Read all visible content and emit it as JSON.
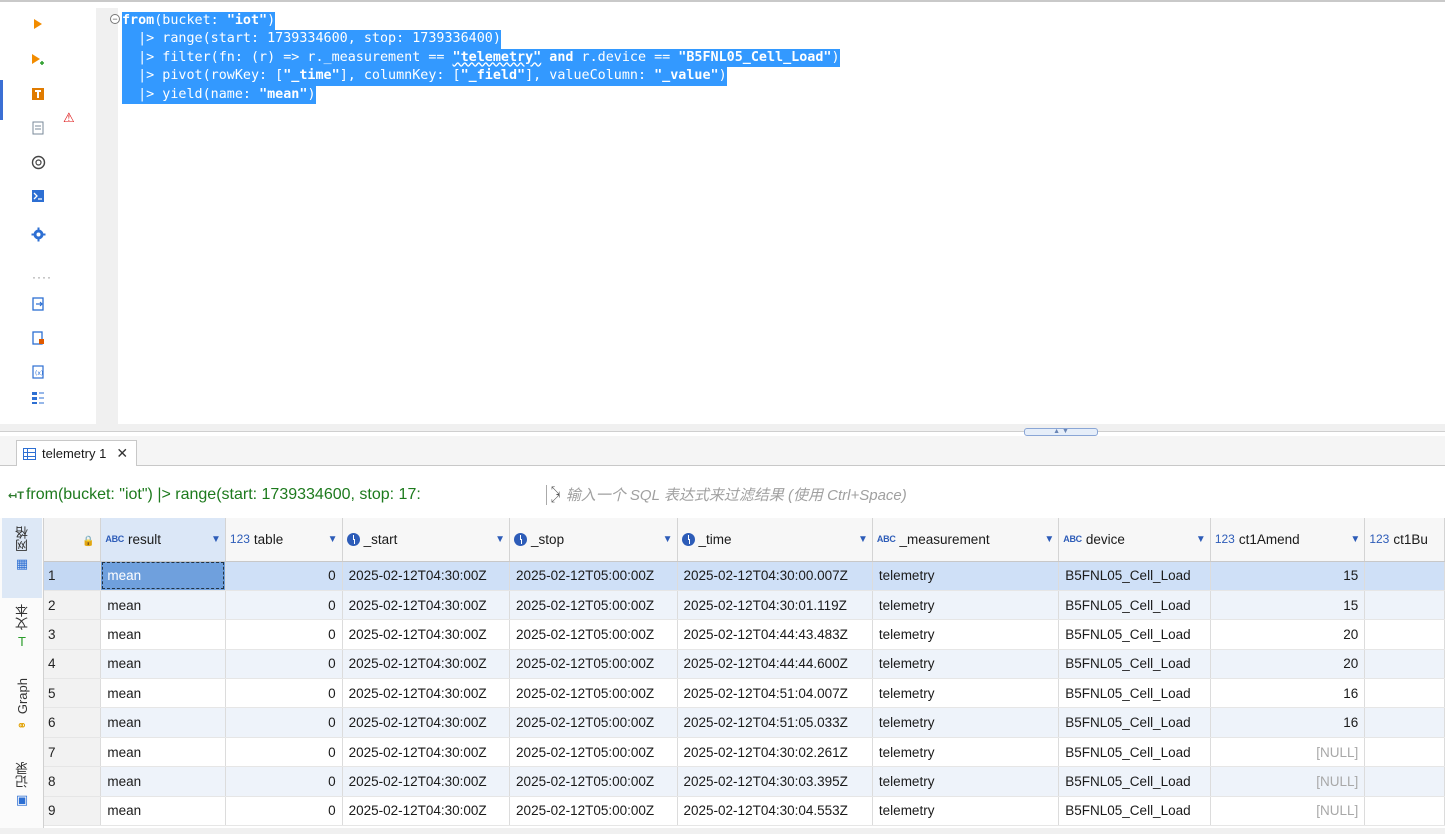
{
  "editor": {
    "lines": [
      {
        "p1": "from",
        "p2": "(bucket: ",
        "p3": "\"iot\"",
        "p4": ")"
      },
      {
        "text": "  |> range(start: 1739334600, stop: 1739336400)"
      },
      {
        "p1": "  |> filter(fn: (r) => r._measurement == ",
        "p2": "\"telemetry\"",
        "p3": " and ",
        "p4": "r.device == ",
        "p5": "\"B5FNL05_Cell_Load\"",
        "p6": ")"
      },
      {
        "p1": "  |> pivot(rowKey: [",
        "p2": "\"_time\"",
        "p3": "], columnKey: [",
        "p4": "\"_field\"",
        "p5": "], valueColumn: ",
        "p6": "\"_value\"",
        "p7": ")"
      },
      {
        "p1": "  |> yield(name: ",
        "p2": "\"mean\"",
        "p3": ")"
      }
    ],
    "toolbar_icons": [
      "run-icon",
      "run-script-icon",
      "explain-icon",
      "export-icon",
      "openai-icon",
      "terminal-icon",
      "settings-icon",
      "load-script-icon",
      "new-script-icon",
      "script-variables-icon",
      "outline-icon"
    ],
    "selection_color": "#3399ff"
  },
  "results": {
    "tab_label": "telemetry 1",
    "tab_close": "✕",
    "filter_query": "from(bucket: \"iot\") |> range(start: 1739334600, stop: 17:",
    "filter_placeholder": "输入一个 SQL 表达式来过滤结果 (使用 Ctrl+Space)",
    "side_tabs": {
      "grid": "网格",
      "text": "文本",
      "graph": "Graph",
      "records": "记录"
    },
    "columns": [
      {
        "type": "ABC",
        "name": "result"
      },
      {
        "type": "123",
        "name": "table"
      },
      {
        "type": "time",
        "name": "_start"
      },
      {
        "type": "time",
        "name": "_stop"
      },
      {
        "type": "time",
        "name": "_time"
      },
      {
        "type": "ABC",
        "name": "_measurement"
      },
      {
        "type": "ABC",
        "name": "device"
      },
      {
        "type": "123",
        "name": "ct1Amend"
      },
      {
        "type": "123",
        "name": "ct1Bu"
      }
    ],
    "rows": [
      {
        "n": "1",
        "result": "mean",
        "table": "0",
        "start": "2025-02-12T04:30:00Z",
        "stop": "2025-02-12T05:00:00Z",
        "time": "2025-02-12T04:30:00.007Z",
        "measurement": "telemetry",
        "device": "B5FNL05_Cell_Load",
        "ct1Amend": "15"
      },
      {
        "n": "2",
        "result": "mean",
        "table": "0",
        "start": "2025-02-12T04:30:00Z",
        "stop": "2025-02-12T05:00:00Z",
        "time": "2025-02-12T04:30:01.119Z",
        "measurement": "telemetry",
        "device": "B5FNL05_Cell_Load",
        "ct1Amend": "15"
      },
      {
        "n": "3",
        "result": "mean",
        "table": "0",
        "start": "2025-02-12T04:30:00Z",
        "stop": "2025-02-12T05:00:00Z",
        "time": "2025-02-12T04:44:43.483Z",
        "measurement": "telemetry",
        "device": "B5FNL05_Cell_Load",
        "ct1Amend": "20"
      },
      {
        "n": "4",
        "result": "mean",
        "table": "0",
        "start": "2025-02-12T04:30:00Z",
        "stop": "2025-02-12T05:00:00Z",
        "time": "2025-02-12T04:44:44.600Z",
        "measurement": "telemetry",
        "device": "B5FNL05_Cell_Load",
        "ct1Amend": "20"
      },
      {
        "n": "5",
        "result": "mean",
        "table": "0",
        "start": "2025-02-12T04:30:00Z",
        "stop": "2025-02-12T05:00:00Z",
        "time": "2025-02-12T04:51:04.007Z",
        "measurement": "telemetry",
        "device": "B5FNL05_Cell_Load",
        "ct1Amend": "16"
      },
      {
        "n": "6",
        "result": "mean",
        "table": "0",
        "start": "2025-02-12T04:30:00Z",
        "stop": "2025-02-12T05:00:00Z",
        "time": "2025-02-12T04:51:05.033Z",
        "measurement": "telemetry",
        "device": "B5FNL05_Cell_Load",
        "ct1Amend": "16"
      },
      {
        "n": "7",
        "result": "mean",
        "table": "0",
        "start": "2025-02-12T04:30:00Z",
        "stop": "2025-02-12T05:00:00Z",
        "time": "2025-02-12T04:30:02.261Z",
        "measurement": "telemetry",
        "device": "B5FNL05_Cell_Load",
        "ct1Amend": "[NULL]"
      },
      {
        "n": "8",
        "result": "mean",
        "table": "0",
        "start": "2025-02-12T04:30:00Z",
        "stop": "2025-02-12T05:00:00Z",
        "time": "2025-02-12T04:30:03.395Z",
        "measurement": "telemetry",
        "device": "B5FNL05_Cell_Load",
        "ct1Amend": "[NULL]"
      },
      {
        "n": "9",
        "result": "mean",
        "table": "0",
        "start": "2025-02-12T04:30:00Z",
        "stop": "2025-02-12T05:00:00Z",
        "time": "2025-02-12T04:30:04.553Z",
        "measurement": "telemetry",
        "device": "B5FNL05_Cell_Load",
        "ct1Amend": "[NULL]"
      }
    ]
  }
}
